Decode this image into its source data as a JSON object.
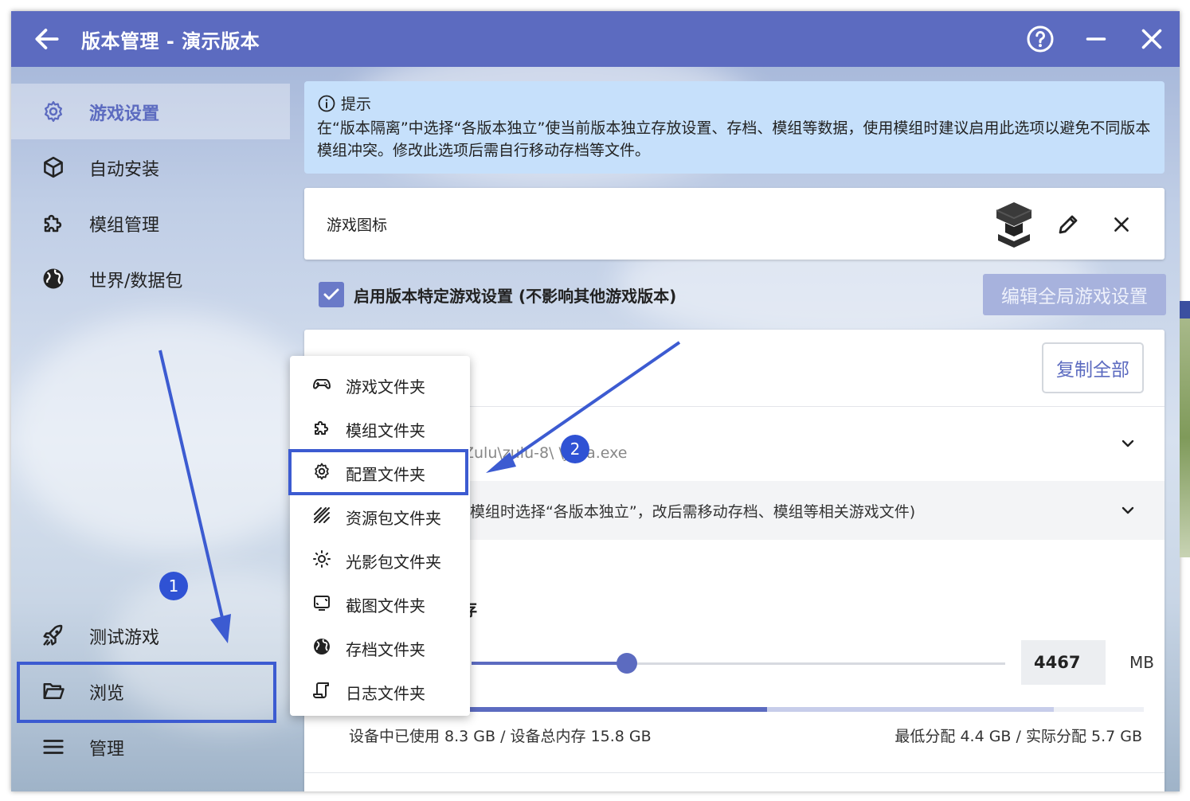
{
  "window": {
    "title": "版本管理 - 演示版本"
  },
  "sidebar": {
    "items": [
      {
        "label": "游戏设置",
        "icon": "gear-icon",
        "active": true
      },
      {
        "label": "自动安装",
        "icon": "cube-icon"
      },
      {
        "label": "模组管理",
        "icon": "puzzle-icon"
      },
      {
        "label": "世界/数据包",
        "icon": "globe-icon"
      }
    ],
    "bottom_items": [
      {
        "label": "测试游戏",
        "icon": "rocket-icon"
      },
      {
        "label": "浏览",
        "icon": "folder-open-icon"
      },
      {
        "label": "管理",
        "icon": "menu-icon"
      }
    ]
  },
  "hint": {
    "title": "提示",
    "body": "在“版本隔离”中选择“各版本独立”使当前版本独立存放设置、存档、模组等数据，使用模组时建议启用此选项以避免不同版本模组冲突。修改此选项后需自行移动存档等文件。"
  },
  "game_icon": {
    "label": "游戏图标"
  },
  "special_settings": {
    "label": "启用版本特定游戏设置 (不影响其他游戏版本)",
    "checked": true,
    "edit_global_label": "编辑全局游戏设置"
  },
  "copy_all_label": "复制全部",
  "java_path_partial": "Zulu\\zulu-8\\     \\java.exe",
  "isolation_partial": "模组时选择“各版本独立”，改后需移动存档、模组等相关游戏文件)",
  "memory": {
    "title_partial": "存",
    "value": "4467",
    "unit": "MB",
    "slider_fraction": 0.28,
    "used_text": "设备中已使用 8.3 GB / 设备总内存 15.8 GB",
    "alloc_text": "最低分配 4.4 GB / 实际分配 5.7 GB"
  },
  "browse_menu": {
    "items": [
      {
        "label": "游戏文件夹",
        "icon": "gamepad-icon"
      },
      {
        "label": "模组文件夹",
        "icon": "puzzle-icon"
      },
      {
        "label": "配置文件夹",
        "icon": "gear-icon"
      },
      {
        "label": "资源包文件夹",
        "icon": "texture-icon"
      },
      {
        "label": "光影包文件夹",
        "icon": "sun-icon"
      },
      {
        "label": "截图文件夹",
        "icon": "screenshot-icon"
      },
      {
        "label": "存档文件夹",
        "icon": "globe-icon"
      },
      {
        "label": "日志文件夹",
        "icon": "script-icon"
      }
    ]
  },
  "annotations": {
    "step1": "1",
    "step2": "2",
    "color": "#3c5bd1"
  },
  "colors": {
    "accent": "#5c6bc0",
    "hint_bg": "#c6e0fb"
  }
}
